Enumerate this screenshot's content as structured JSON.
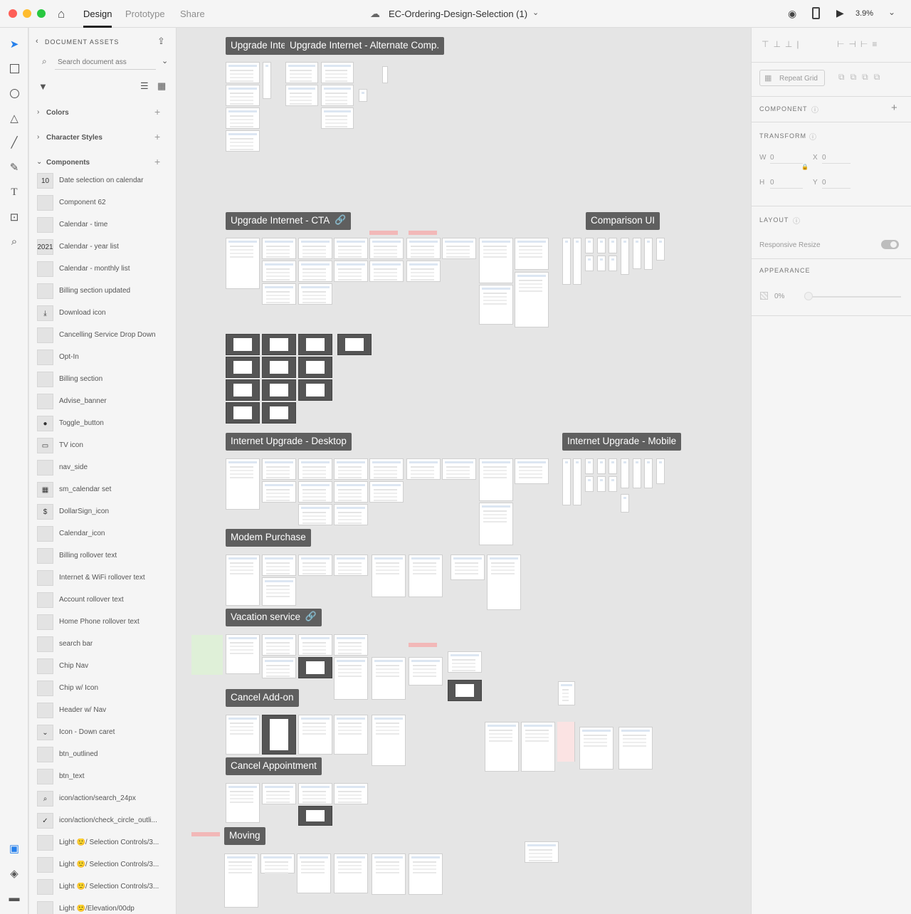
{
  "topbar": {
    "tabs": [
      "Design",
      "Prototype",
      "Share"
    ],
    "doc_title": "EC-Ordering-Design-Selection (1)",
    "zoom": "3.9%",
    "traffic_colors": [
      "#fe5f57",
      "#febc2e",
      "#28c840"
    ]
  },
  "assets": {
    "header": "DOCUMENT ASSETS",
    "search_placeholder": "Search document ass",
    "sections": {
      "colors": "Colors",
      "character_styles": "Character Styles",
      "components": "Components"
    },
    "components": [
      {
        "label": "Date selection on calendar",
        "thumb": "10"
      },
      {
        "label": "Component 62",
        "thumb": ""
      },
      {
        "label": "Calendar - time",
        "thumb": ""
      },
      {
        "label": "Calendar - year list",
        "thumb": "2021"
      },
      {
        "label": "Calendar - monthly list",
        "thumb": ""
      },
      {
        "label": "Billing section updated",
        "thumb": ""
      },
      {
        "label": "Download icon",
        "thumb": "⤓"
      },
      {
        "label": "Cancelling Service Drop Down",
        "thumb": ""
      },
      {
        "label": "Opt-In",
        "thumb": ""
      },
      {
        "label": "Billing section",
        "thumb": ""
      },
      {
        "label": "Advise_banner",
        "thumb": ""
      },
      {
        "label": "Toggle_button",
        "thumb": "●"
      },
      {
        "label": "TV icon",
        "thumb": "▭"
      },
      {
        "label": "nav_side",
        "thumb": ""
      },
      {
        "label": "sm_calendar set",
        "thumb": "▦"
      },
      {
        "label": "DollarSign_icon",
        "thumb": "$"
      },
      {
        "label": "Calendar_icon",
        "thumb": ""
      },
      {
        "label": "Billing rollover text",
        "thumb": ""
      },
      {
        "label": "Internet & WiFi rollover text",
        "thumb": ""
      },
      {
        "label": "Account rollover text",
        "thumb": ""
      },
      {
        "label": "Home Phone rollover text",
        "thumb": ""
      },
      {
        "label": "search bar",
        "thumb": ""
      },
      {
        "label": "Chip Nav",
        "thumb": ""
      },
      {
        "label": "Chip w/ Icon",
        "thumb": ""
      },
      {
        "label": "Header w/ Nav",
        "thumb": ""
      },
      {
        "label": "Icon - Down caret",
        "thumb": "⌄"
      },
      {
        "label": "btn_outlined",
        "thumb": ""
      },
      {
        "label": "btn_text",
        "thumb": ""
      },
      {
        "label": "icon/action/search_24px",
        "thumb": "⌕"
      },
      {
        "label": "icon/action/check_circle_outli...",
        "thumb": "✓"
      },
      {
        "label": "Light 🙂/ Selection Controls/3...",
        "thumb": ""
      },
      {
        "label": "Light 🙂/ Selection Controls/3...",
        "thumb": ""
      },
      {
        "label": "Light 🙂/ Selection Controls/3...",
        "thumb": ""
      },
      {
        "label": "Light 🙂/Elevation/00dp",
        "thumb": ""
      }
    ]
  },
  "props": {
    "repeat_grid": "Repeat Grid",
    "component": "COMPONENT",
    "transform": "TRANSFORM",
    "w_label": "W",
    "w_value": "0",
    "x_label": "X",
    "x_value": "0",
    "h_label": "H",
    "h_value": "0",
    "y_label": "Y",
    "y_value": "0",
    "layout": "LAYOUT",
    "responsive_resize": "Responsive Resize",
    "appearance": "APPEARANCE",
    "opacity": "0%"
  },
  "canvas": {
    "groups": [
      "Upgrade Inte",
      "Upgrade Internet - Alternate Comp.",
      "Upgrade Internet - CTA",
      "Comparison UI",
      "Internet Upgrade - Desktop",
      "Internet Upgrade - Mobile",
      "Modem Purchase",
      "Vacation service",
      "Cancel Add-on",
      "Cancel Appointment",
      "Moving"
    ]
  }
}
